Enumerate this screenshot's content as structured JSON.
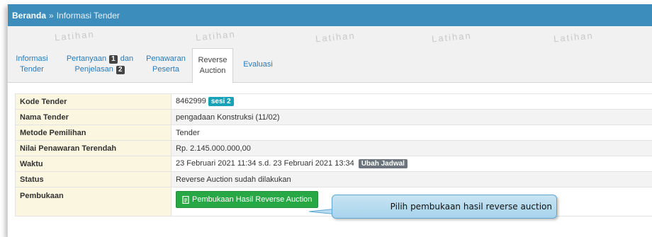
{
  "breadcrumb": {
    "home": "Beranda",
    "separator": "»",
    "current": "Informasi Tender"
  },
  "watermark": "Latihan",
  "tabs": [
    {
      "line1": "Informasi",
      "line2": "Tender",
      "active": false
    },
    {
      "line1_pre": "Pertanyaan",
      "line1_badge": "1",
      "line1_post": "dan",
      "line2_pre": "Penjelasan",
      "line2_badge": "2",
      "active": false
    },
    {
      "line1": "Penawaran",
      "line2": "Peserta",
      "active": false
    },
    {
      "line1": "Reverse",
      "line2": "Auction",
      "active": true
    },
    {
      "line1": "Evaluasi",
      "active": false
    }
  ],
  "info": {
    "kode": {
      "label": "Kode Tender",
      "value": "8462999",
      "badge": "sesi 2"
    },
    "nama": {
      "label": "Nama Tender",
      "value": "pengadaan Konstruksi (11/02)"
    },
    "metode": {
      "label": "Metode Pemilihan",
      "value": "Tender"
    },
    "nilai": {
      "label": "Nilai Penawaran Terendah",
      "value": "Rp. 2.145.000.000,00"
    },
    "waktu": {
      "label": "Waktu",
      "value": "23 Februari 2021 11:34 s.d. 23 Februari 2021 13:34",
      "badge": "Ubah Jadwal"
    },
    "status": {
      "label": "Status",
      "value": "Reverse Auction sudah dilakukan"
    },
    "pembukaan": {
      "label": "Pembukaan",
      "button": "Pembukaan Hasil Reverse Auction"
    }
  },
  "callout": "Pilih pembukaan hasil reverse auction",
  "colors": {
    "topbar": "#3c8dbc",
    "label_bg": "#fbf6e0",
    "button_green": "#28a745",
    "badge_sesi": "#17a2b8",
    "badge_ubah": "#6c757d",
    "callout_fill": "#b9dcf0"
  }
}
